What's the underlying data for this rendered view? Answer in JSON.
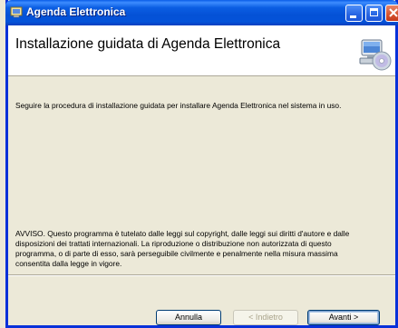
{
  "window": {
    "title": "Agenda Elettronica",
    "controls": [
      "minimize",
      "maximize",
      "close"
    ]
  },
  "header": {
    "title": "Installazione guidata di Agenda Elettronica",
    "icon": "computer-cd-installer-icon"
  },
  "body": {
    "intro": "Seguire la procedura di installazione guidata per installare Agenda Elettronica nel sistema in uso.",
    "warning_lines": [
      "AVVISO. Questo programma è tutelato dalle leggi sul copyright, dalle leggi sui diritti d'autore e dalle",
      "disposizioni dei trattati internazionali. La riproduzione o distribuzione non autorizzata di questo",
      "programma, o di parte di esso, sarà perseguibile civilmente e penalmente nella misura massima",
      "consentita dalla legge in vigore."
    ]
  },
  "buttons": {
    "cancel": "Annulla",
    "back": "< Indietro",
    "next": "Avanti >"
  },
  "colors": {
    "titlebar": "#0453d9",
    "window_bg": "#ece9d8",
    "border": "#0831d9"
  }
}
